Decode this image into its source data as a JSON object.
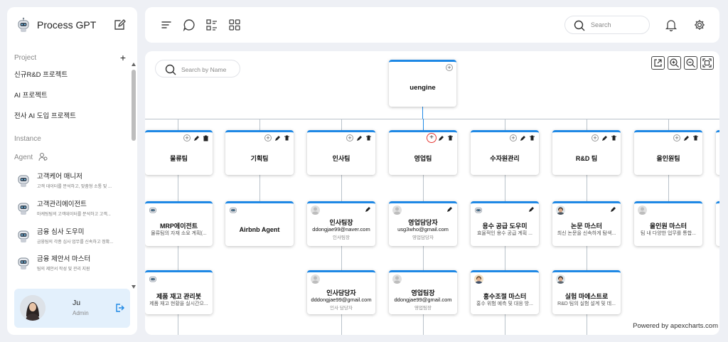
{
  "app": {
    "title": "Process GPT"
  },
  "sidebar": {
    "project_label": "Project",
    "projects": [
      "신규R&D 프로젝트",
      "AI 프로젝트",
      "전사 AI 도입 프로젝트"
    ],
    "instance_label": "Instance",
    "agent_label": "Agent",
    "agents": [
      {
        "name": "고객케어 매니저",
        "desc": "고객 데이터를 분석하고, 맞춤형 소통 및 ..."
      },
      {
        "name": "고객관리에이전트",
        "desc": "마케팅팀의 고객데이터를 분석하고 고객..."
      },
      {
        "name": "금융 심사 도우미",
        "desc": "금융팀의 각종 심사 업무를 신속하고 정확..."
      },
      {
        "name": "금융 제안서 마스터",
        "desc": "팀의 제안서 작성 및 관리 지원"
      }
    ],
    "user": {
      "name": "Ju",
      "role": "Admin"
    }
  },
  "topbar": {
    "search_placeholder": "Search"
  },
  "org": {
    "search_placeholder": "Search by Name",
    "root": {
      "name": "uengine"
    },
    "teams": [
      "물류팀",
      "기획팀",
      "인사팀",
      "영업팀",
      "수자원관리",
      "R&D 팀",
      "올인원팀"
    ],
    "row2": [
      {
        "title": "MRP에이전트",
        "line1": "물류팀의 자재 소요 계획(...",
        "line2": "",
        "kind": "robot"
      },
      {
        "title": "Airbnb Agent",
        "line1": "",
        "line2": "",
        "kind": "robot"
      },
      {
        "title": "인사팀장",
        "line1": "ddongjae99@naver.com",
        "line2": "인사팀장",
        "kind": "person"
      },
      {
        "title": "영업담당자",
        "line1": "usg3who@gmail.com",
        "line2": "영업담당자",
        "kind": "person"
      },
      {
        "title": "용수 공급 도우미",
        "line1": "효율적인 용수 공급 계획 ...",
        "line2": "",
        "kind": "robot"
      },
      {
        "title": "논문 마스터",
        "line1": "최신 논문을 신속하게 탐색...",
        "line2": "",
        "kind": "man"
      },
      {
        "title": "올인원 마스터",
        "line1": "팀 내 다양한 업무를 통합...",
        "line2": "",
        "kind": "person"
      }
    ],
    "row3": [
      {
        "title": "제품 재고 관리봇",
        "line1": "제품 재고 현황을 실시간으...",
        "line2": "",
        "kind": "robot"
      },
      {
        "title": "인사담당자",
        "line1": "dddongjae99@gmail.com",
        "line2": "인사 담당자",
        "kind": "person"
      },
      {
        "title": "영업팀장",
        "line1": "ddongjae99@gmail.com",
        "line2": "영업팀장",
        "kind": "person"
      },
      {
        "title": "홍수조절 마스터",
        "line1": "홍수 위험 예측 및 대응 방...",
        "line2": "",
        "kind": "man"
      },
      {
        "title": "실험 마에스트로",
        "line1": "R&D 팀의 실험 설계 및 데...",
        "line2": "",
        "kind": "man"
      }
    ],
    "powered_by": "Powered by apexcharts.com"
  },
  "colors": {
    "accent": "#1e88e5",
    "highlight": "#e53935",
    "user_card": "#e3f0fc"
  }
}
